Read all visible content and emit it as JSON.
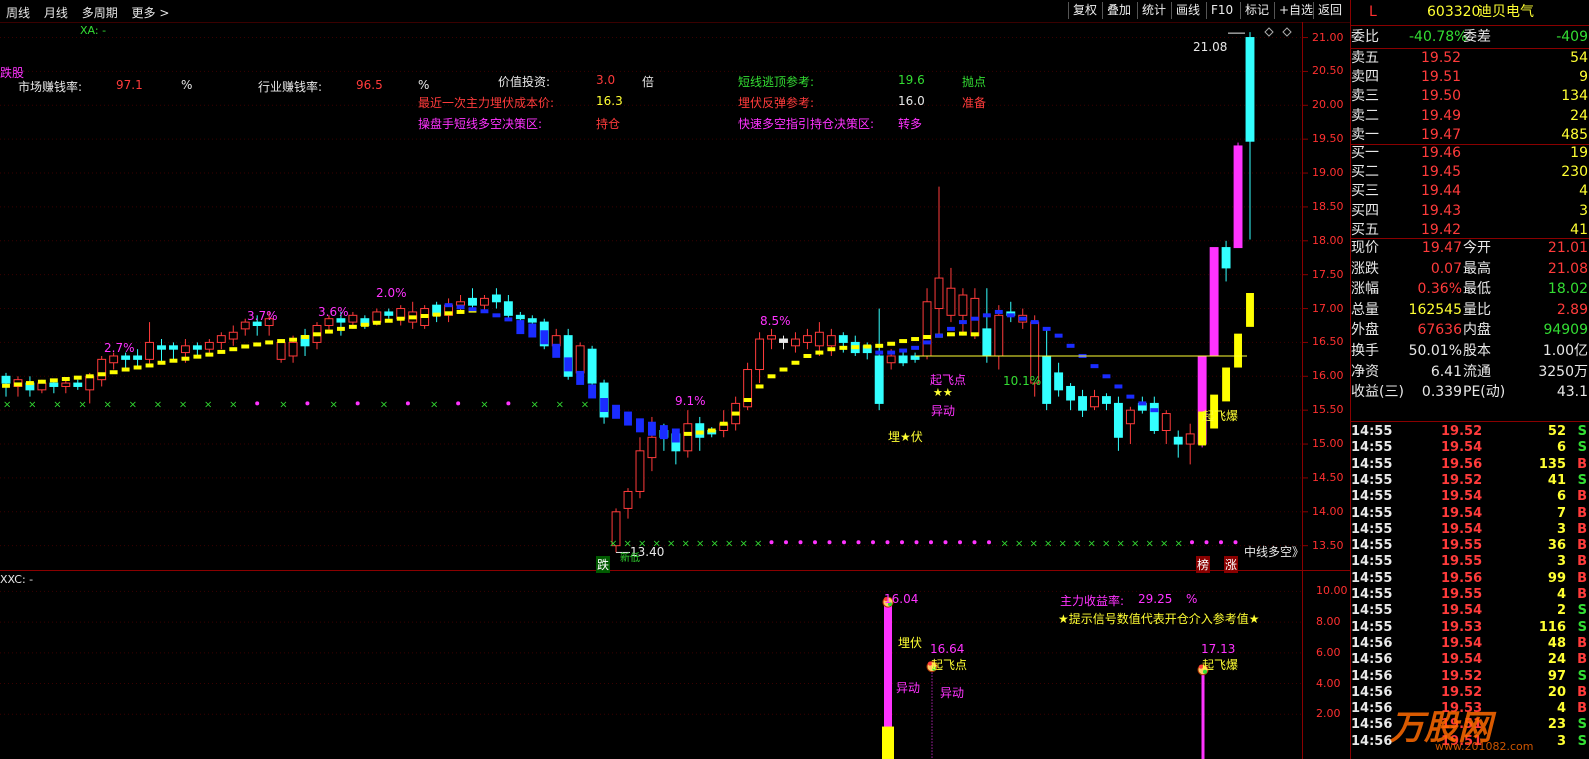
{
  "toolbar": {
    "left_items": [
      "周线",
      "月线",
      "多周期",
      "更多 >"
    ],
    "right_buttons": [
      "复权",
      "叠加",
      "统计",
      "画线",
      "F10",
      "标记",
      "+自选",
      "返回"
    ]
  },
  "main_panel": {
    "indicator_title": "XA: -",
    "left_tag": "跌股",
    "labels": {
      "market_rate_label": "市场赚钱率:",
      "market_rate_value": "97.1",
      "market_rate_unit": "%",
      "industry_rate_label": "行业赚钱率:",
      "industry_rate_value": "96.5",
      "industry_rate_unit": "%",
      "value_invest_label": "价值投资:",
      "value_invest_value": "3.0",
      "value_invest_unit": "倍",
      "short_top_label": "短线逃顶参考:",
      "short_top_value": "19.6",
      "short_top_tag": "抛点",
      "ambush_cost_label": "最近一次主力埋伏成本价:",
      "ambush_cost_value": "16.3",
      "ambush_rebound_label": "埋伏反弹参考:",
      "ambush_rebound_value": "16.0",
      "ambush_rebound_tag": "准备",
      "trader_zone_label": "操盘手短线多空决策区:",
      "trader_zone_value": "持仓",
      "quick_zone_label": "快速多空指引持仓决策区:",
      "quick_zone_value": "转多"
    },
    "annotations": {
      "p1": "2.7%",
      "p2": "3.7%",
      "p3": "3.6%",
      "p4": "2.0%",
      "p5": "8.5%",
      "p6": "9.1%",
      "p7": "10.1%",
      "high_price": "21.08",
      "low_price": "13.40",
      "takeoff_point": "起飞点",
      "stars": "★★",
      "abnormal": "异动",
      "ambush": "埋★伏",
      "takeoff_burst": "起飞爆",
      "fall_tag": "跌",
      "mid_line": "中线多空》",
      "tag_a": "榜",
      "tag_b": "涨",
      "low_sub": "新低"
    },
    "y_axis": [
      "21.00",
      "20.50",
      "20.00",
      "19.50",
      "19.00",
      "18.50",
      "18.00",
      "17.50",
      "17.00",
      "16.50",
      "16.00",
      "15.50",
      "15.00",
      "14.50",
      "14.00",
      "13.50"
    ]
  },
  "sub_panel": {
    "indicator_title": "XXC: -",
    "main_profit_label": "主力收益率:",
    "main_profit_value": "29.25",
    "main_profit_unit": "%",
    "hint": "★提示信号数值代表开仓介入参考值★",
    "v1": "16.04",
    "v1_tag": "埋伏",
    "v1_tag2": "异动",
    "v2": "16.64",
    "v2_tag": "起飞点",
    "v2_tag2": "异动",
    "v3": "17.13",
    "v3_tag": "起飞爆",
    "y_axis": [
      "10.00",
      "8.00",
      "6.00",
      "4.00",
      "2.00"
    ]
  },
  "quote": {
    "flag": "L",
    "code": "603320",
    "name": "迪贝电气",
    "weibi_label": "委比",
    "weibi_value": "-40.78%",
    "weicha_label": "委差",
    "weicha_value": "-409",
    "asks": [
      {
        "label": "卖五",
        "price": "19.52",
        "vol": "54"
      },
      {
        "label": "卖四",
        "price": "19.51",
        "vol": "9"
      },
      {
        "label": "卖三",
        "price": "19.50",
        "vol": "134"
      },
      {
        "label": "卖二",
        "price": "19.49",
        "vol": "24"
      },
      {
        "label": "卖一",
        "price": "19.47",
        "vol": "485"
      }
    ],
    "bids": [
      {
        "label": "买一",
        "price": "19.46",
        "vol": "19"
      },
      {
        "label": "买二",
        "price": "19.45",
        "vol": "230"
      },
      {
        "label": "买三",
        "price": "19.44",
        "vol": "4"
      },
      {
        "label": "买四",
        "price": "19.43",
        "vol": "3"
      },
      {
        "label": "买五",
        "price": "19.42",
        "vol": "41"
      }
    ],
    "stats": [
      {
        "l1": "现价",
        "v1": "19.47",
        "c1": "r",
        "l2": "今开",
        "v2": "21.01",
        "c2": "r"
      },
      {
        "l1": "涨跌",
        "v1": "0.07",
        "c1": "r",
        "l2": "最高",
        "v2": "21.08",
        "c2": "r"
      },
      {
        "l1": "涨幅",
        "v1": "0.36%",
        "c1": "r",
        "l2": "最低",
        "v2": "18.02",
        "c2": "g"
      },
      {
        "l1": "总量",
        "v1": "162545",
        "c1": "y",
        "l2": "量比",
        "v2": "2.89",
        "c2": "r"
      },
      {
        "l1": "外盘",
        "v1": "67636",
        "c1": "r",
        "l2": "内盘",
        "v2": "94909",
        "c2": "g"
      },
      {
        "l1": "换手",
        "v1": "50.01%",
        "c1": "w",
        "l2": "股本",
        "v2": "1.00亿",
        "c2": "w"
      },
      {
        "l1": "净资",
        "v1": "6.41",
        "c1": "w",
        "l2": "流通",
        "v2": "3250万",
        "c2": "w"
      },
      {
        "l1": "收益(三)",
        "v1": "0.339",
        "c1": "w",
        "l2": "PE(动)",
        "v2": "43.1",
        "c2": "w"
      }
    ],
    "ticks": [
      {
        "t": "14:55",
        "p": "19.52",
        "v": "52",
        "s": "S"
      },
      {
        "t": "14:55",
        "p": "19.54",
        "v": "6",
        "s": "S"
      },
      {
        "t": "14:55",
        "p": "19.56",
        "v": "135",
        "s": "B"
      },
      {
        "t": "14:55",
        "p": "19.52",
        "v": "41",
        "s": "S"
      },
      {
        "t": "14:55",
        "p": "19.54",
        "v": "6",
        "s": "B"
      },
      {
        "t": "14:55",
        "p": "19.54",
        "v": "7",
        "s": "B"
      },
      {
        "t": "14:55",
        "p": "19.54",
        "v": "3",
        "s": "B"
      },
      {
        "t": "14:55",
        "p": "19.55",
        "v": "36",
        "s": "B"
      },
      {
        "t": "14:55",
        "p": "19.55",
        "v": "3",
        "s": "B"
      },
      {
        "t": "14:55",
        "p": "19.56",
        "v": "99",
        "s": "B"
      },
      {
        "t": "14:55",
        "p": "19.55",
        "v": "4",
        "s": "B"
      },
      {
        "t": "14:55",
        "p": "19.54",
        "v": "2",
        "s": "S"
      },
      {
        "t": "14:55",
        "p": "19.53",
        "v": "116",
        "s": "S"
      },
      {
        "t": "14:56",
        "p": "19.54",
        "v": "48",
        "s": "B"
      },
      {
        "t": "14:56",
        "p": "19.54",
        "v": "24",
        "s": "B"
      },
      {
        "t": "14:56",
        "p": "19.52",
        "v": "97",
        "s": "S"
      },
      {
        "t": "14:56",
        "p": "19.52",
        "v": "20",
        "s": "B"
      },
      {
        "t": "14:56",
        "p": "19.53",
        "v": "4",
        "s": "B"
      },
      {
        "t": "14:56",
        "p": "19.51",
        "v": "23",
        "s": "S"
      },
      {
        "t": "14:56",
        "p": "19.51",
        "v": "3",
        "s": "S"
      }
    ]
  },
  "watermark": {
    "text": "万股网",
    "url": "www.201082.com"
  },
  "chart_data": {
    "type": "candlestick",
    "ylim": [
      13.2,
      21.2
    ],
    "high": 21.08,
    "low": 13.4,
    "ref_line": 16.3,
    "candles": [
      [
        15.9,
        16.0,
        15.7,
        16.05,
        "c"
      ],
      [
        15.95,
        15.85,
        15.7,
        16.0,
        "r"
      ],
      [
        15.9,
        15.8,
        15.7,
        16.0,
        "c"
      ],
      [
        15.8,
        15.9,
        15.75,
        15.95,
        "r"
      ],
      [
        15.9,
        15.85,
        15.75,
        15.95,
        "c"
      ],
      [
        15.85,
        15.9,
        15.75,
        15.95,
        "r"
      ],
      [
        15.9,
        15.85,
        15.8,
        15.95,
        "c"
      ],
      [
        15.8,
        16.0,
        15.6,
        16.05,
        "r"
      ],
      [
        15.95,
        16.25,
        15.85,
        16.3,
        "r"
      ],
      [
        16.2,
        16.3,
        16.1,
        16.35,
        "r"
      ],
      [
        16.3,
        16.25,
        16.1,
        16.35,
        "c"
      ],
      [
        16.25,
        16.3,
        16.15,
        16.4,
        "c"
      ],
      [
        16.25,
        16.5,
        16.15,
        16.8,
        "r"
      ],
      [
        16.45,
        16.4,
        16.2,
        16.55,
        "c"
      ],
      [
        16.4,
        16.45,
        16.25,
        16.5,
        "c"
      ],
      [
        16.35,
        16.45,
        16.2,
        16.55,
        "r"
      ],
      [
        16.45,
        16.4,
        16.3,
        16.5,
        "c"
      ],
      [
        16.4,
        16.5,
        16.3,
        16.55,
        "r"
      ],
      [
        16.5,
        16.6,
        16.4,
        16.65,
        "r"
      ],
      [
        16.55,
        16.65,
        16.45,
        16.75,
        "r"
      ],
      [
        16.7,
        16.8,
        16.6,
        16.85,
        "r"
      ],
      [
        16.8,
        16.75,
        16.6,
        16.9,
        "c"
      ],
      [
        16.75,
        16.85,
        16.6,
        16.95,
        "r"
      ],
      [
        16.5,
        16.25,
        16.2,
        16.55,
        "r"
      ],
      [
        16.3,
        16.5,
        16.2,
        16.6,
        "r"
      ],
      [
        16.6,
        16.45,
        16.3,
        16.7,
        "c"
      ],
      [
        16.5,
        16.75,
        16.4,
        16.8,
        "r"
      ],
      [
        16.75,
        16.85,
        16.65,
        16.9,
        "r"
      ],
      [
        16.85,
        16.8,
        16.6,
        16.95,
        "c"
      ],
      [
        16.8,
        16.9,
        16.7,
        16.95,
        "r"
      ],
      [
        16.85,
        16.75,
        16.7,
        16.9,
        "c"
      ],
      [
        16.8,
        16.95,
        16.75,
        17.0,
        "r"
      ],
      [
        16.95,
        16.9,
        16.85,
        17.0,
        "c"
      ],
      [
        16.85,
        17.0,
        16.75,
        17.05,
        "r"
      ],
      [
        16.95,
        16.8,
        16.7,
        17.1,
        "r"
      ],
      [
        16.75,
        17.0,
        16.7,
        17.05,
        "r"
      ],
      [
        17.05,
        16.9,
        16.8,
        17.1,
        "c"
      ],
      [
        16.9,
        17.05,
        16.8,
        17.15,
        "r"
      ],
      [
        17.05,
        17.1,
        16.95,
        17.2,
        "r"
      ],
      [
        17.15,
        17.05,
        16.95,
        17.3,
        "c"
      ],
      [
        17.05,
        17.15,
        16.95,
        17.2,
        "r"
      ],
      [
        17.2,
        17.1,
        17.0,
        17.3,
        "c"
      ],
      [
        17.1,
        16.9,
        16.85,
        17.2,
        "c"
      ],
      [
        16.9,
        16.85,
        16.8,
        16.95,
        "c"
      ],
      [
        16.85,
        16.8,
        16.75,
        16.9,
        "c"
      ],
      [
        16.8,
        16.45,
        16.4,
        16.85,
        "c"
      ],
      [
        16.45,
        16.6,
        16.35,
        16.7,
        "r"
      ],
      [
        16.6,
        16.0,
        15.95,
        16.7,
        "c"
      ],
      [
        16.05,
        16.45,
        16.0,
        16.5,
        "r"
      ],
      [
        16.4,
        15.9,
        15.85,
        16.45,
        "c"
      ],
      [
        15.9,
        15.4,
        15.3,
        15.95,
        "c"
      ],
      [
        13.5,
        14.0,
        13.4,
        14.05,
        "r"
      ],
      [
        14.05,
        14.3,
        13.9,
        14.35,
        "r"
      ],
      [
        14.3,
        14.9,
        14.2,
        15.1,
        "r"
      ],
      [
        14.8,
        15.1,
        14.6,
        15.4,
        "r"
      ],
      [
        15.1,
        15.2,
        14.9,
        15.3,
        "c"
      ],
      [
        15.15,
        14.9,
        14.7,
        15.2,
        "c"
      ],
      [
        14.9,
        15.3,
        14.8,
        15.5,
        "r"
      ],
      [
        15.3,
        15.1,
        14.9,
        15.4,
        "c"
      ],
      [
        15.15,
        15.2,
        15.1,
        15.25,
        "c"
      ],
      [
        15.2,
        15.3,
        15.1,
        15.5,
        "r"
      ],
      [
        15.3,
        15.6,
        15.2,
        15.7,
        "r"
      ],
      [
        15.55,
        16.1,
        15.5,
        16.2,
        "r"
      ],
      [
        16.1,
        16.55,
        15.9,
        16.65,
        "r"
      ],
      [
        16.55,
        16.6,
        16.4,
        16.7,
        "r"
      ],
      [
        16.5,
        16.55,
        16.4,
        16.6,
        "w"
      ],
      [
        16.45,
        16.55,
        16.35,
        16.65,
        "r"
      ],
      [
        16.5,
        16.6,
        16.4,
        16.7,
        "r"
      ],
      [
        16.65,
        16.45,
        16.3,
        16.8,
        "r"
      ],
      [
        16.45,
        16.6,
        16.3,
        16.7,
        "r"
      ],
      [
        16.6,
        16.5,
        16.35,
        16.65,
        "c"
      ],
      [
        16.5,
        16.35,
        16.3,
        16.6,
        "c"
      ],
      [
        16.35,
        16.45,
        16.25,
        16.5,
        "c"
      ],
      [
        15.6,
        16.3,
        15.5,
        17.0,
        "c"
      ],
      [
        16.3,
        16.2,
        16.1,
        16.4,
        "r"
      ],
      [
        16.2,
        16.3,
        16.15,
        16.4,
        "c"
      ],
      [
        16.25,
        16.3,
        16.2,
        16.35,
        "c"
      ],
      [
        16.3,
        17.1,
        16.25,
        17.3,
        "r"
      ],
      [
        17.0,
        17.45,
        16.6,
        18.8,
        "r"
      ],
      [
        17.3,
        16.9,
        16.8,
        17.6,
        "r"
      ],
      [
        16.9,
        17.2,
        16.6,
        17.3,
        "r"
      ],
      [
        17.15,
        16.6,
        16.55,
        17.3,
        "r"
      ],
      [
        16.7,
        16.3,
        16.2,
        17.3,
        "c"
      ],
      [
        16.3,
        16.9,
        16.1,
        17.05,
        "r"
      ],
      [
        16.95,
        16.9,
        16.8,
        17.1,
        "c"
      ],
      [
        16.9,
        16.8,
        16.7,
        17.0,
        "r"
      ],
      [
        16.8,
        15.9,
        15.7,
        16.9,
        "r"
      ],
      [
        16.3,
        15.6,
        15.5,
        16.7,
        "c"
      ],
      [
        16.05,
        15.8,
        15.7,
        16.2,
        "c"
      ],
      [
        15.85,
        15.65,
        15.5,
        15.9,
        "c"
      ],
      [
        15.7,
        15.5,
        15.4,
        15.8,
        "c"
      ],
      [
        15.55,
        15.7,
        15.5,
        15.8,
        "r"
      ],
      [
        15.7,
        15.6,
        15.5,
        15.75,
        "c"
      ],
      [
        15.6,
        15.1,
        14.9,
        15.7,
        "c"
      ],
      [
        15.3,
        15.5,
        15.0,
        15.55,
        "r"
      ],
      [
        15.5,
        15.6,
        15.45,
        15.7,
        "c"
      ],
      [
        15.6,
        15.2,
        15.15,
        15.7,
        "c"
      ],
      [
        15.2,
        15.45,
        15.0,
        15.5,
        "r"
      ],
      [
        15.1,
        15.0,
        14.8,
        15.2,
        "c"
      ],
      [
        15.0,
        15.15,
        14.7,
        15.3,
        "r"
      ],
      [
        15.0,
        16.3,
        14.95,
        16.3,
        "m"
      ],
      [
        16.3,
        17.9,
        16.3,
        17.9,
        "m"
      ],
      [
        17.9,
        17.6,
        17.4,
        18.0,
        "c"
      ],
      [
        17.9,
        19.4,
        17.9,
        19.45,
        "m"
      ],
      [
        19.47,
        21.0,
        18.02,
        21.08,
        "c"
      ]
    ],
    "ma_yellow": [
      15.86,
      15.88,
      15.9,
      15.92,
      15.94,
      15.96,
      15.98,
      16.0,
      16.03,
      16.06,
      16.1,
      16.13,
      16.16,
      16.2,
      16.23,
      16.26,
      16.29,
      16.32,
      16.36,
      16.4,
      16.44,
      16.47,
      16.5,
      16.52,
      16.54,
      16.58,
      16.62,
      16.66,
      16.7,
      16.73,
      16.76,
      16.79,
      16.82,
      16.85,
      16.87,
      16.89,
      16.91,
      16.93,
      16.95,
      16.97,
      null,
      null,
      null,
      null,
      null,
      null,
      null,
      null,
      null,
      null,
      null,
      null,
      null,
      null,
      null,
      null,
      null,
      15.15,
      15.17,
      15.2,
      15.3,
      15.45,
      15.65,
      15.85,
      16.0,
      16.1,
      16.2,
      16.3,
      16.35,
      16.4,
      16.42,
      16.43,
      16.44,
      16.45,
      16.48,
      16.52,
      16.55,
      16.58,
      16.6,
      16.62,
      16.63,
      16.62,
      null,
      null,
      null,
      null,
      null,
      null,
      null,
      null,
      null,
      null,
      null,
      null,
      null,
      null,
      null,
      null,
      null,
      null,
      15.45,
      15.7,
      16.1,
      16.6,
      17.2
    ],
    "ma_blue": [
      null,
      null,
      null,
      null,
      null,
      null,
      null,
      null,
      null,
      null,
      null,
      null,
      null,
      null,
      null,
      null,
      null,
      null,
      null,
      null,
      null,
      null,
      null,
      null,
      null,
      null,
      null,
      null,
      null,
      null,
      null,
      null,
      null,
      null,
      null,
      null,
      null,
      17.05,
      17.02,
      16.99,
      16.96,
      16.9,
      16.84,
      16.8,
      16.75,
      16.65,
      16.45,
      16.25,
      16.05,
      15.85,
      15.65,
      15.55,
      15.45,
      15.35,
      15.3,
      15.25,
      15.2,
      null,
      null,
      null,
      null,
      null,
      null,
      null,
      null,
      null,
      null,
      null,
      null,
      null,
      null,
      null,
      null,
      16.35,
      16.35,
      16.38,
      16.42,
      16.5,
      16.6,
      16.7,
      16.8,
      16.85,
      16.9,
      16.95,
      16.9,
      16.85,
      16.8,
      16.7,
      16.6,
      16.45,
      16.3,
      16.15,
      16.0,
      15.85,
      15.7,
      15.6,
      15.5,
      null,
      null,
      null,
      null,
      null
    ]
  }
}
